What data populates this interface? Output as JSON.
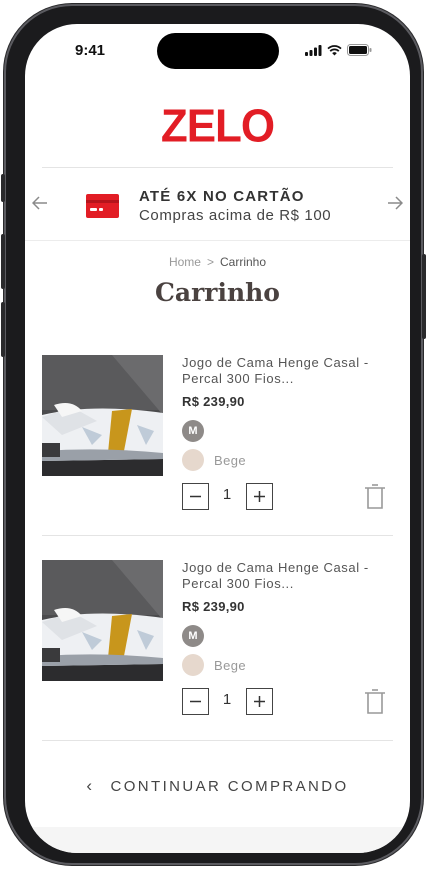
{
  "status_bar": {
    "time": "9:41"
  },
  "brand": {
    "logo": "ZELO",
    "color": "#e21d25"
  },
  "promo": {
    "title": "ATÉ 6X NO CARTÃO",
    "subtitle": "Compras acima de R$ 100",
    "icon": "credit-card-icon",
    "prev_icon": "arrow-left-icon",
    "next_icon": "arrow-right-icon"
  },
  "breadcrumb": {
    "home": "Home",
    "separator": ">",
    "current": "Carrinho"
  },
  "page": {
    "title": "Carrinho"
  },
  "cart": {
    "items": [
      {
        "name": "Jogo de Cama Henge Casal - Percal 300 Fios...",
        "price": "R$ 239,90",
        "size": "M",
        "color_name": "Bege",
        "color_hex": "#e6d8cd",
        "quantity": "1"
      },
      {
        "name": "Jogo de Cama Henge Casal - Percal 300 Fios...",
        "price": "R$ 239,90",
        "size": "M",
        "color_name": "Bege",
        "color_hex": "#e6d8cd",
        "quantity": "1"
      }
    ]
  },
  "actions": {
    "continue_label": "CONTINUAR COMPRANDO",
    "continue_icon": "chevron-left-icon"
  }
}
